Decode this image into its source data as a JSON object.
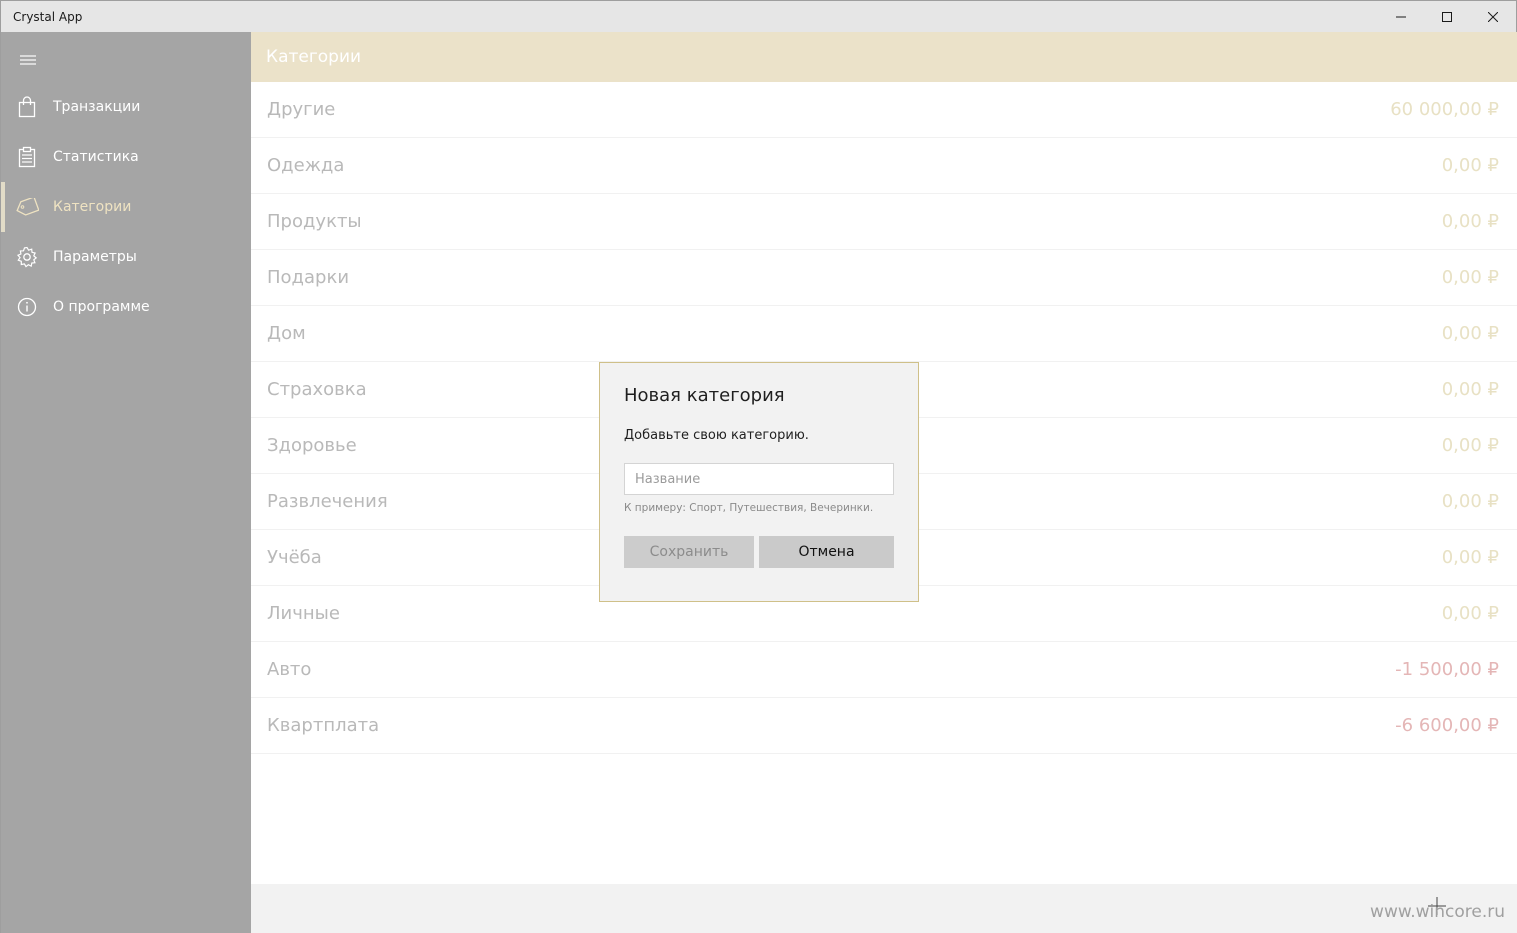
{
  "window": {
    "title": "Crystal App"
  },
  "sidebar": {
    "items": [
      {
        "label": "Транзакции",
        "icon": "shopping-bag-icon"
      },
      {
        "label": "Статистика",
        "icon": "clipboard-icon"
      },
      {
        "label": "Категории",
        "icon": "tag-icon",
        "active": true
      },
      {
        "label": "Параметры",
        "icon": "gear-icon"
      },
      {
        "label": "О программе",
        "icon": "info-icon"
      }
    ]
  },
  "header": {
    "title": "Категории"
  },
  "categories": [
    {
      "name": "Другие",
      "amount": "60 000,00 ₽"
    },
    {
      "name": "Одежда",
      "amount": "0,00 ₽"
    },
    {
      "name": "Продукты",
      "amount": "0,00 ₽"
    },
    {
      "name": "Подарки",
      "amount": "0,00 ₽"
    },
    {
      "name": "Дом",
      "amount": "0,00 ₽"
    },
    {
      "name": "Страховка",
      "amount": "0,00 ₽"
    },
    {
      "name": "Здоровье",
      "amount": "0,00 ₽"
    },
    {
      "name": "Развлечения",
      "amount": "0,00 ₽"
    },
    {
      "name": "Учёба",
      "amount": "0,00 ₽"
    },
    {
      "name": "Личные",
      "amount": "0,00 ₽"
    },
    {
      "name": "Авто",
      "amount": "-1 500,00 ₽"
    },
    {
      "name": "Квартплата",
      "amount": "-6 600,00 ₽"
    }
  ],
  "dialog": {
    "title": "Новая категория",
    "text": "Добавьте свою категорию.",
    "input_value": "",
    "input_placeholder": "Название",
    "hint": "К примеру: Спорт, Путешествия, Вечеринки.",
    "save_label": "Сохранить",
    "cancel_label": "Отмена"
  },
  "footer": {
    "watermark": "www.wincore.ru"
  },
  "colors": {
    "sidebar_bg": "#a5a5a5",
    "header_bg": "#ebe2c9",
    "positive_amount": "#e8e1c4",
    "negative_amount": "#e4b6b6",
    "dialog_border": "#cfc089"
  }
}
